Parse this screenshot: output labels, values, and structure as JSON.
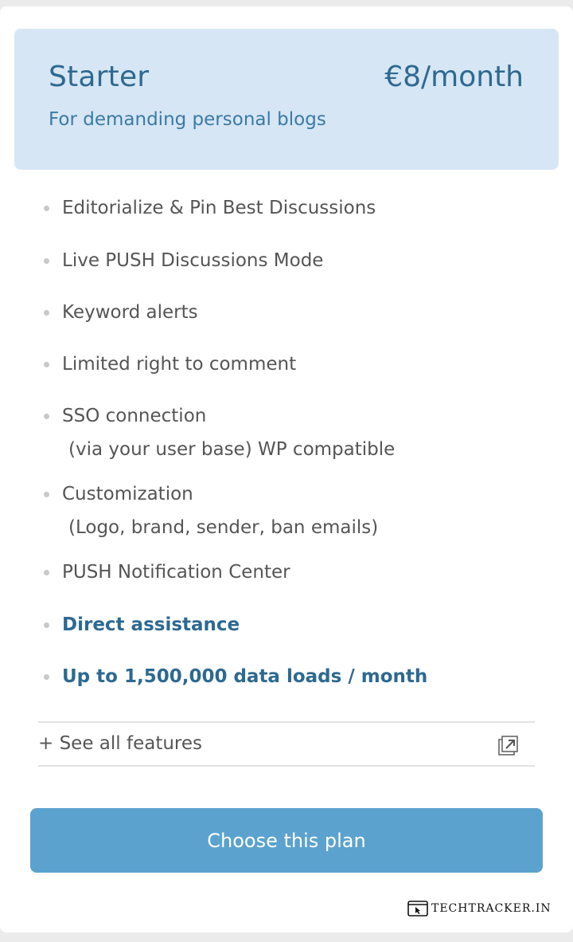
{
  "plan": {
    "name": "Starter",
    "price": "€8/month",
    "description": "For demanding personal blogs"
  },
  "features": [
    {
      "label": "Editorialize & Pin Best Discussions",
      "sub": "",
      "highlight": false
    },
    {
      "label": "Live PUSH Discussions Mode",
      "sub": "",
      "highlight": false
    },
    {
      "label": "Keyword alerts",
      "sub": "",
      "highlight": false
    },
    {
      "label": "Limited right to comment",
      "sub": "",
      "highlight": false
    },
    {
      "label": "SSO connection",
      "sub": "(via your user base) WP compatible",
      "highlight": false
    },
    {
      "label": "Customization",
      "sub": "(Logo, brand, sender, ban emails)",
      "highlight": false
    },
    {
      "label": "PUSH Notification Center",
      "sub": "",
      "highlight": false
    },
    {
      "label": "Direct assistance",
      "sub": "",
      "highlight": true
    },
    {
      "label": "Up to 1,500,000 data loads / month",
      "sub": "",
      "highlight": true
    }
  ],
  "see_all": {
    "label": "+ See all features",
    "icon": "external-link-icon"
  },
  "cta": {
    "label": "Choose this plan"
  },
  "watermark": {
    "text": "TECHTRACKER.IN",
    "icon": "browser-cursor-icon"
  },
  "colors": {
    "header_bg": "#d6e6f4",
    "accent": "#2d6991",
    "button": "#5ba2cf"
  }
}
